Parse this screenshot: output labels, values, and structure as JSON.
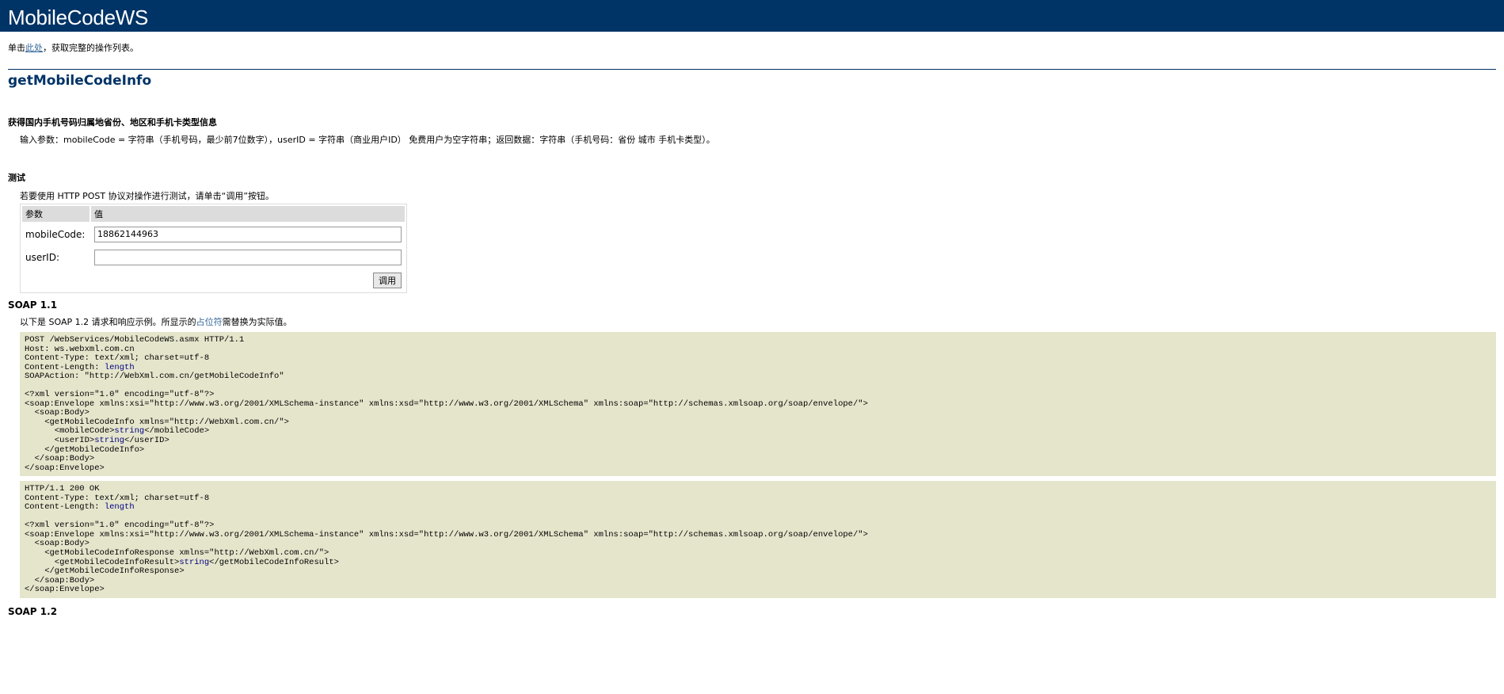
{
  "banner": {
    "title": "MobileCodeWS"
  },
  "intro": {
    "prefix": "单击",
    "link": "此处",
    "suffix": "，获取完整的操作列表。"
  },
  "operation": {
    "name": "getMobileCodeInfo",
    "desc_title": "获得国内手机号码归属地省份、地区和手机卡类型信息",
    "desc_text": "输入参数：mobileCode = 字符串（手机号码，最少前7位数字），userID = 字符串（商业用户ID） 免费用户为空字符串；返回数据：字符串（手机号码：省份 城市 手机卡类型）。"
  },
  "test": {
    "title": "测试",
    "note": "若要使用 HTTP POST 协议对操作进行测试，请单击“调用”按钮。",
    "col_param": "参数",
    "col_value": "值",
    "params": [
      {
        "label": "mobileCode:",
        "value": "18862144963"
      },
      {
        "label": "userID:",
        "value": ""
      }
    ],
    "invoke_label": "调用"
  },
  "soap11": {
    "title": "SOAP 1.1",
    "note_prefix": "以下是 SOAP 1.2 请求和响应示例。所显示的",
    "note_placeholder": "占位符",
    "note_suffix": "需替换为实际值。",
    "request": [
      [
        [
          "POST /WebServices/MobileCodeWS.asmx HTTP/1.1"
        ]
      ],
      [
        [
          "Host: ws.webxml.com.cn"
        ]
      ],
      [
        [
          "Content-Type: text/xml; charset=utf-8"
        ]
      ],
      [
        [
          "Content-Length: "
        ],
        [
          "length",
          1
        ]
      ],
      [
        [
          "SOAPAction: \"http://WebXml.com.cn/getMobileCodeInfo\""
        ]
      ],
      [
        [
          ""
        ]
      ],
      [
        [
          "<?xml version=\"1.0\" encoding=\"utf-8\"?>"
        ]
      ],
      [
        [
          "<soap:Envelope xmlns:xsi=\"http://www.w3.org/2001/XMLSchema-instance\" xmlns:xsd=\"http://www.w3.org/2001/XMLSchema\" xmlns:soap=\"http://schemas.xmlsoap.org/soap/envelope/\">"
        ]
      ],
      [
        [
          "  <soap:Body>"
        ]
      ],
      [
        [
          "    <getMobileCodeInfo xmlns=\"http://WebXml.com.cn/\">"
        ]
      ],
      [
        [
          "      <mobileCode>"
        ],
        [
          "string",
          1
        ],
        [
          "</mobileCode>"
        ]
      ],
      [
        [
          "      <userID>"
        ],
        [
          "string",
          1
        ],
        [
          "</userID>"
        ]
      ],
      [
        [
          "    </getMobileCodeInfo>"
        ]
      ],
      [
        [
          "  </soap:Body>"
        ]
      ],
      [
        [
          "</soap:Envelope>"
        ]
      ]
    ],
    "response": [
      [
        [
          "HTTP/1.1 200 OK"
        ]
      ],
      [
        [
          "Content-Type: text/xml; charset=utf-8"
        ]
      ],
      [
        [
          "Content-Length: "
        ],
        [
          "length",
          1
        ]
      ],
      [
        [
          ""
        ]
      ],
      [
        [
          "<?xml version=\"1.0\" encoding=\"utf-8\"?>"
        ]
      ],
      [
        [
          "<soap:Envelope xmlns:xsi=\"http://www.w3.org/2001/XMLSchema-instance\" xmlns:xsd=\"http://www.w3.org/2001/XMLSchema\" xmlns:soap=\"http://schemas.xmlsoap.org/soap/envelope/\">"
        ]
      ],
      [
        [
          "  <soap:Body>"
        ]
      ],
      [
        [
          "    <getMobileCodeInfoResponse xmlns=\"http://WebXml.com.cn/\">"
        ]
      ],
      [
        [
          "      <getMobileCodeInfoResult>"
        ],
        [
          "string",
          1
        ],
        [
          "</getMobileCodeInfoResult>"
        ]
      ],
      [
        [
          "    </getMobileCodeInfoResponse>"
        ]
      ],
      [
        [
          "  </soap:Body>"
        ]
      ],
      [
        [
          "</soap:Envelope>"
        ]
      ]
    ]
  },
  "soap12": {
    "title": "SOAP 1.2"
  }
}
